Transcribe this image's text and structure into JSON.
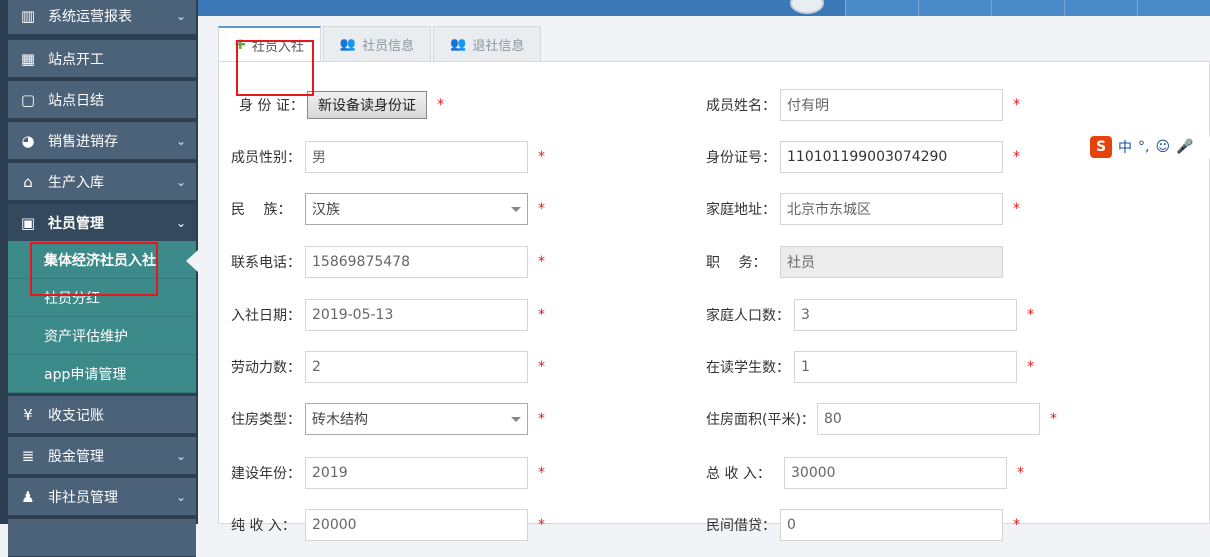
{
  "sidebar": {
    "items": [
      {
        "label": "系统运营报表",
        "icon": "bar-chart-icon",
        "glyph": "▥",
        "chevron": true
      },
      {
        "label": "站点开工",
        "icon": "calendar-icon",
        "glyph": "▦",
        "chevron": false
      },
      {
        "label": "站点日结",
        "icon": "calendar-blank-icon",
        "glyph": "▢",
        "chevron": false
      },
      {
        "label": "销售进销存",
        "icon": "pie-chart-icon",
        "glyph": "◕",
        "chevron": true
      },
      {
        "label": "生产入库",
        "icon": "bank-icon",
        "glyph": "⌂",
        "chevron": true
      },
      {
        "label": "社员管理",
        "icon": "image-icon",
        "glyph": "▣",
        "chevron": true
      },
      {
        "label": "收支记账",
        "icon": "yen-icon",
        "glyph": "¥",
        "chevron": false
      },
      {
        "label": "股金管理",
        "icon": "database-icon",
        "glyph": "≣",
        "chevron": true
      },
      {
        "label": "非社员管理",
        "icon": "person-icon",
        "glyph": "♟",
        "chevron": true
      }
    ],
    "submenu": [
      "集体经济社员入社",
      "社员分红",
      "资产评估维护",
      "app申请管理"
    ],
    "chevron_glyph": "⌄"
  },
  "tabs": [
    {
      "label": "社员入社",
      "icon": "plus-icon",
      "glyph": "✚"
    },
    {
      "label": "社员信息",
      "icon": "users-icon",
      "glyph": "👥"
    },
    {
      "label": "退社信息",
      "icon": "users-icon",
      "glyph": "👥"
    }
  ],
  "form": {
    "id_card_label": "身 份 证：",
    "read_id_button": "新设备读身份证",
    "name_label": "成员姓名：",
    "name_value": "付有明",
    "gender_label": "成员性别：",
    "gender_value": "男",
    "id_number_label": "身份证号：",
    "id_number_value": "110101199003074290",
    "ethnicity_label": "民　 族：",
    "ethnicity_value": "汉族",
    "address_label": "家庭地址：",
    "address_value": "北京市东城区",
    "phone_label": "联系电话：",
    "phone_value": "15869875478",
    "position_label": "职　 务：",
    "position_value": "社员",
    "join_date_label": "入社日期：",
    "join_date_value": "2019-05-13",
    "household_label": "家庭人口数：",
    "household_value": "3",
    "labor_label": "劳动力数：",
    "labor_value": "2",
    "students_label": "在读学生数：",
    "students_value": "1",
    "housing_type_label": "住房类型：",
    "housing_type_value": "砖木结构",
    "housing_area_label": "住房面积(平米)：",
    "housing_area_value": "80",
    "build_year_label": "建设年份：",
    "build_year_value": "2019",
    "total_income_label": "总 收 入：",
    "total_income_value": "30000",
    "net_income_label": "纯 收 入：",
    "net_income_value": "20000",
    "loan_label": "民间借贷：",
    "loan_value": "0",
    "required_mark": "*"
  },
  "ime": {
    "brand": "S",
    "mode": "中",
    "punct": "°,",
    "emoji": "☺",
    "mic": "🎤"
  }
}
